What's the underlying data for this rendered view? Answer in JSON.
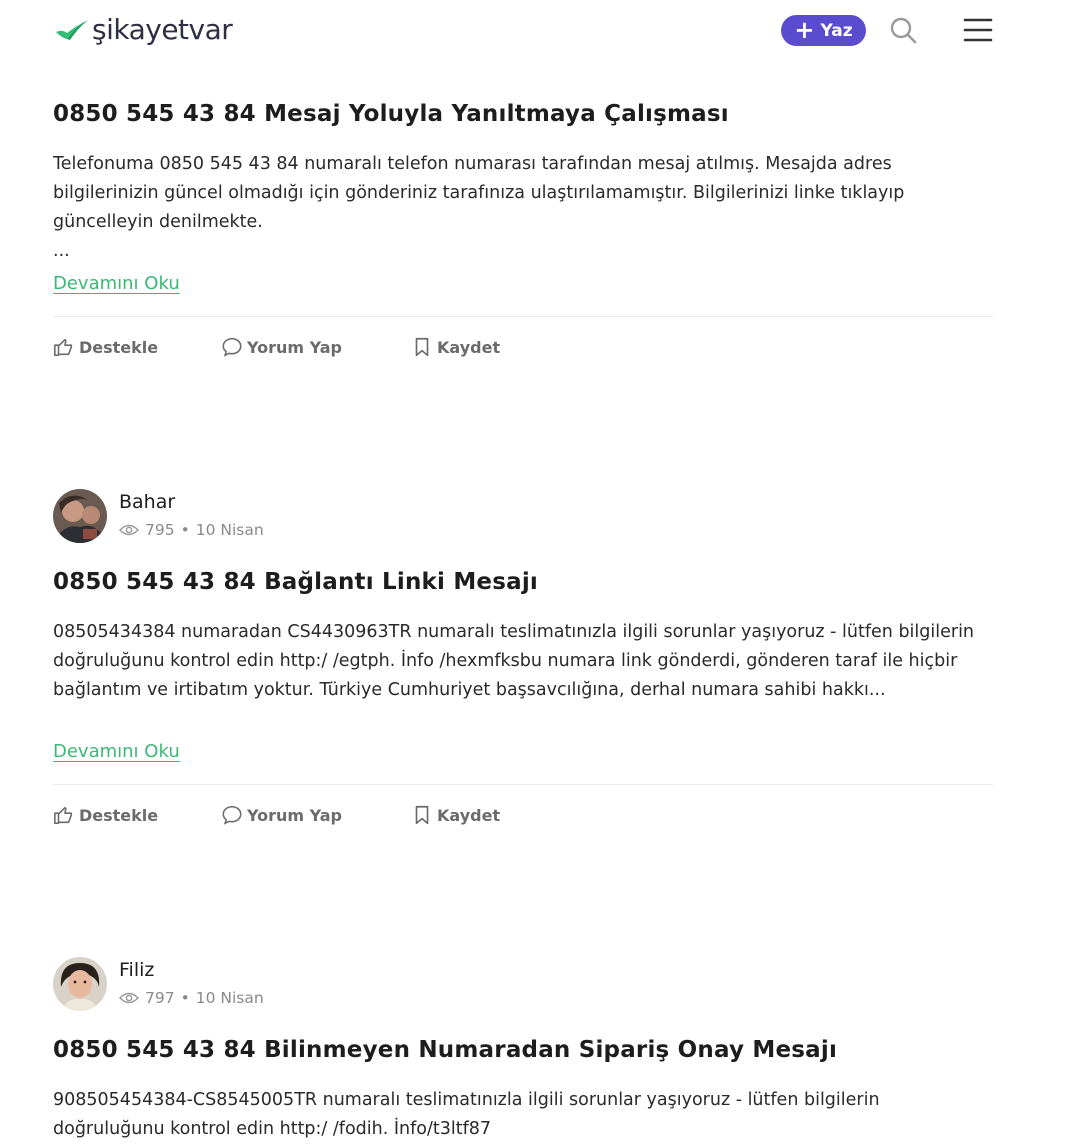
{
  "header": {
    "brand": "şikayetvar",
    "write_button": "Yaz",
    "icons": {
      "logo": "check-mark-icon",
      "plus": "plus-icon",
      "search": "search-icon",
      "menu": "hamburger-menu-icon"
    },
    "colors": {
      "accent": "#5b4ccf",
      "brand_green": "#2fbf77",
      "link": "#3cb876"
    }
  },
  "posts": [
    {
      "title": "0850 545 43 84 Mesaj Yoluyla Yanıltmaya Çalışması",
      "body": [
        "Telefonuma 0850 545 43 84 numaralı telefon numarası tarafından mesaj atılmış. Mesajda adres bilgilerinizin güncel olmadığı için gönderiniz tarafınıza ulaştırılamamıştır. Bilgilerinizi linke tıklayıp güncelleyin denilmekte.",
        "..."
      ],
      "read_more": "Devamını Oku",
      "actions": {
        "support": "Destekle",
        "comment": "Yorum Yap",
        "save": "Kaydet"
      }
    },
    {
      "author": {
        "name": "Bahar",
        "views": "795",
        "date": "10 Nisan"
      },
      "title": "0850 545 43 84 Bağlantı Linki Mesajı",
      "body": [
        "08505434384 numaradan CS4430963TR numaralı teslimatınızla ilgili sorunlar yaşıyoruz - lütfen bilgilerin doğruluğunu kontrol edin http:/ /egtph. İnfo /hexmfksbu numara link gönderdi, gönderen taraf ile hiçbir bağlantım ve irtibatım yoktur. Türkiye Cumhuriyet başsavcılığına, derhal numara sahibi hakkı..."
      ],
      "read_more": "Devamını Oku",
      "actions": {
        "support": "Destekle",
        "comment": "Yorum Yap",
        "save": "Kaydet"
      }
    },
    {
      "author": {
        "name": "Filiz",
        "views": "797",
        "date": "10 Nisan"
      },
      "title": "0850 545 43 84 Bilinmeyen Numaradan Sipariş Onay Mesajı",
      "body": [
        "908505454384-CS8545005TR numaralı teslimatınızla ilgili sorunlar yaşıyoruz - lütfen bilgilerin doğruluğunu kontrol edin http:/ /fodih. İnfo/t3ltf87"
      ]
    }
  ],
  "meta_separator": "•",
  "action_icons": {
    "support": "thumbs-up-icon",
    "comment": "speech-bubble-icon",
    "save": "bookmark-icon",
    "views": "eye-icon"
  }
}
